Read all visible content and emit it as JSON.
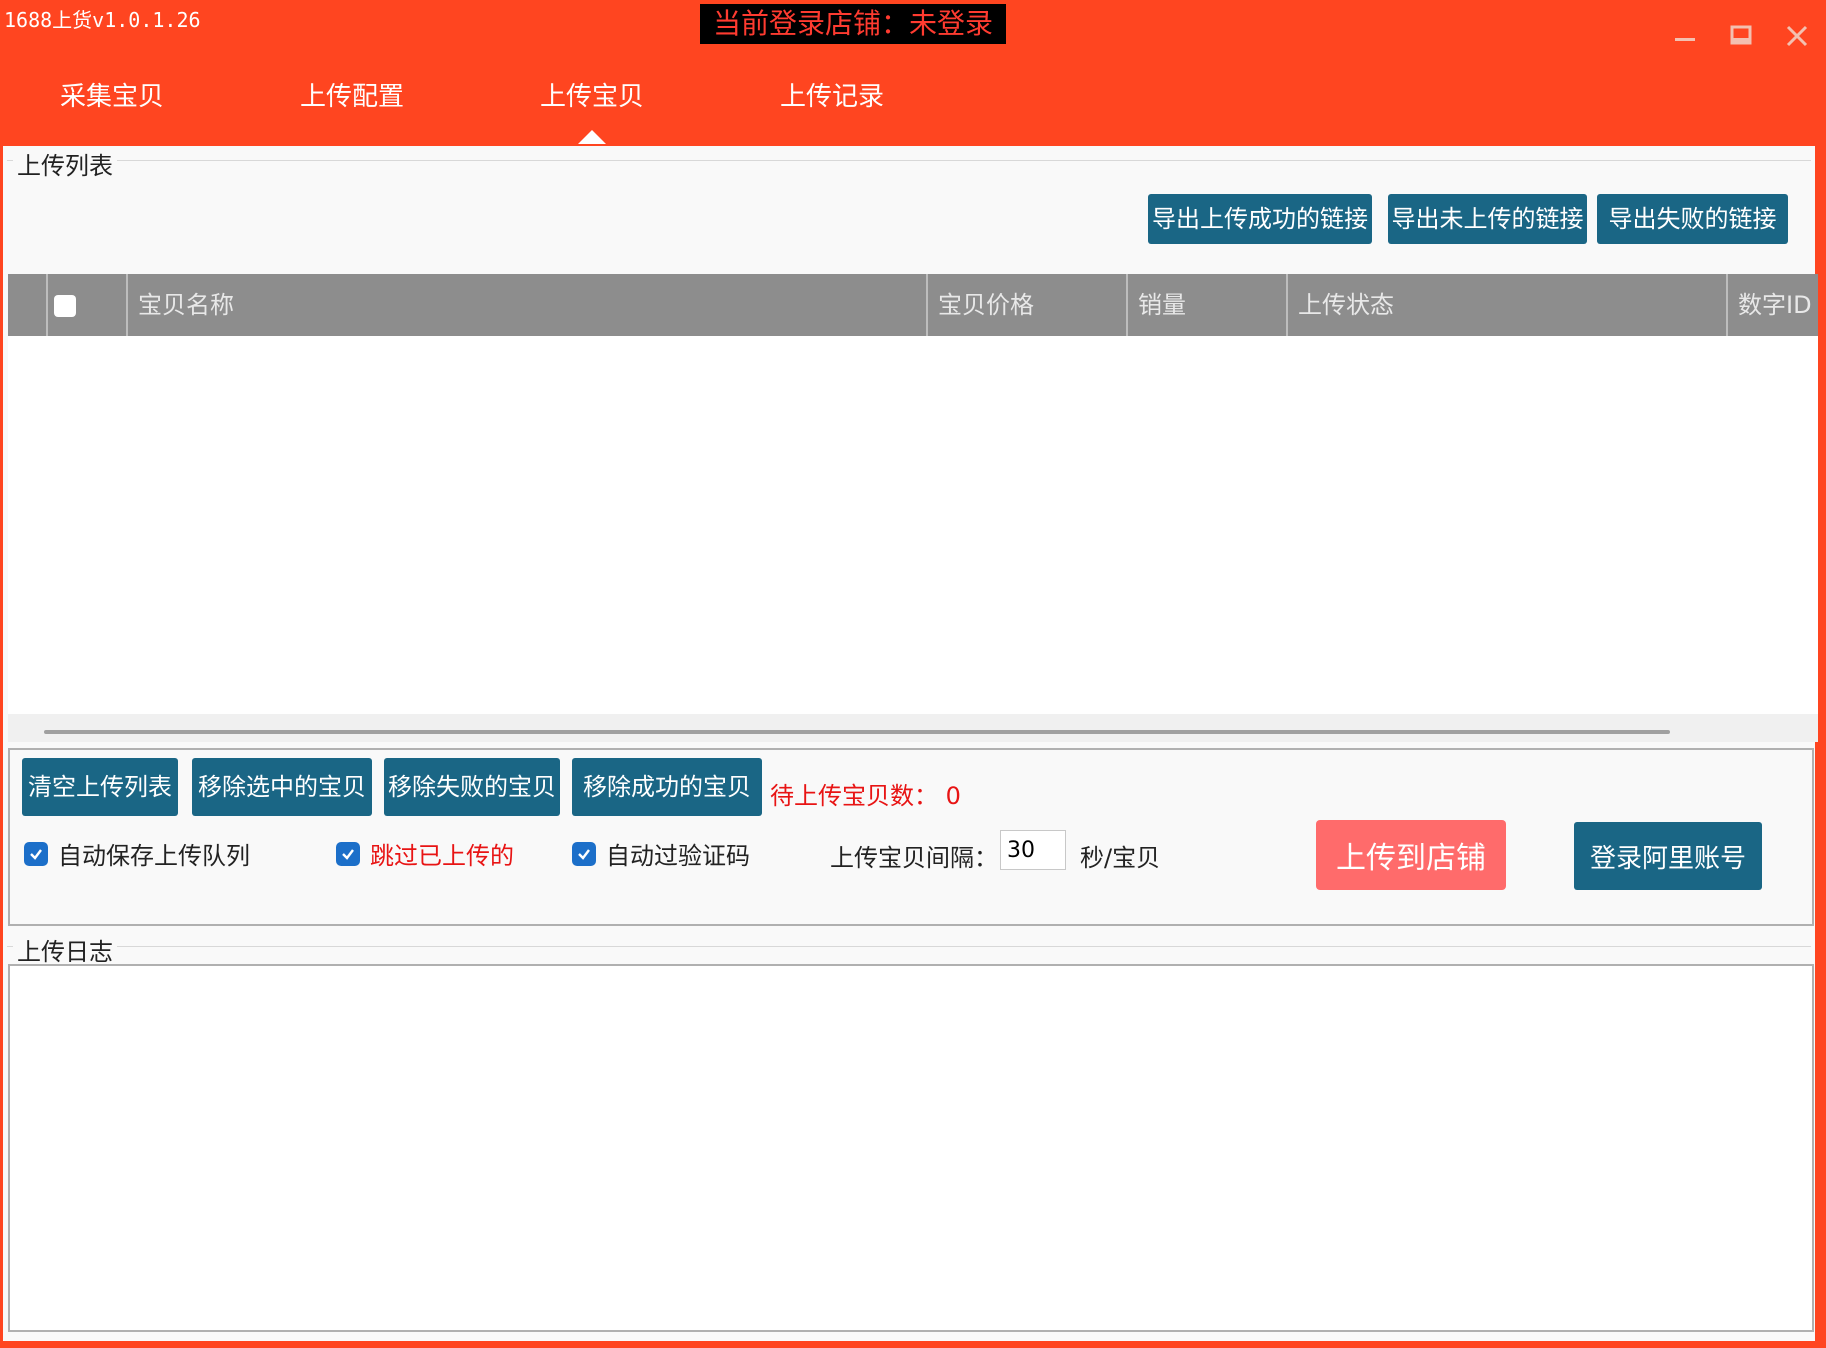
{
  "window": {
    "title": "1688上货v1.0.1.26",
    "login_status": "当前登录店铺：未登录"
  },
  "nav": {
    "tabs": [
      {
        "label": "采集宝贝"
      },
      {
        "label": "上传配置"
      },
      {
        "label": "上传宝贝",
        "active": true
      },
      {
        "label": "上传记录"
      }
    ]
  },
  "upload_list": {
    "group_label": "上传列表",
    "export_buttons": {
      "success": "导出上传成功的链接",
      "not_uploaded": "导出未上传的链接",
      "failed": "导出失败的链接"
    },
    "columns": {
      "select_all": "全选",
      "name": "宝贝名称",
      "price": "宝贝价格",
      "sales": "销量",
      "status": "上传状态",
      "id": "数字ID"
    },
    "rows": []
  },
  "controls": {
    "clear_list": "清空上传列表",
    "remove_selected": "移除选中的宝贝",
    "remove_failed": "移除失败的宝贝",
    "remove_success": "移除成功的宝贝",
    "pending_label": "待上传宝贝数：",
    "pending_count": "0",
    "auto_save": "自动保存上传队列",
    "skip_uploaded": "跳过已上传的",
    "auto_captcha": "自动过验证码",
    "interval_label": "上传宝贝间隔：",
    "interval_value": "30",
    "interval_unit": "秒/宝贝",
    "upload_button": "上传到店铺",
    "login_button": "登录阿里账号"
  },
  "log": {
    "group_label": "上传日志"
  },
  "colors": {
    "brand": "#ff4520",
    "button": "#1a6685",
    "upload_button": "#ff6b6b",
    "warning_text": "#e81414"
  }
}
